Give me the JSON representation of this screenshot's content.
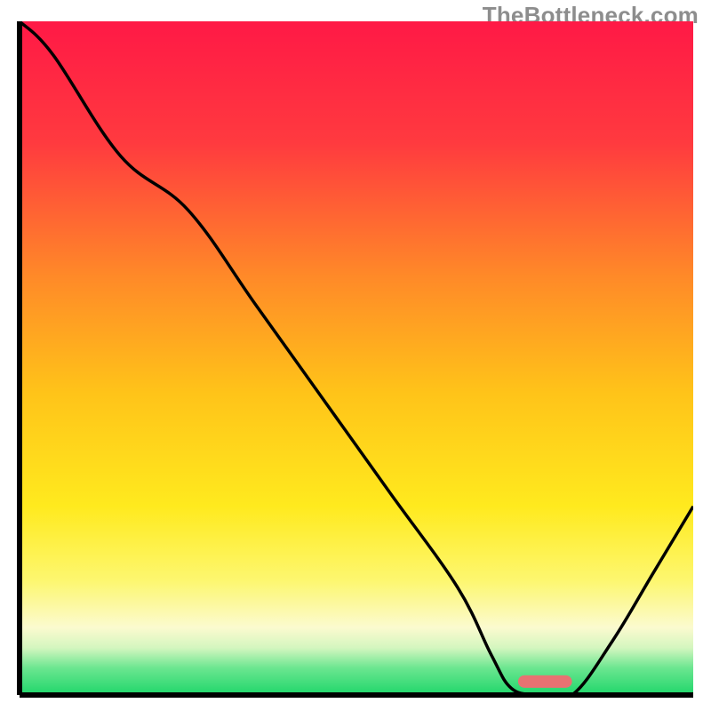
{
  "watermark": "TheBottleneck.com",
  "chart_data": {
    "type": "line",
    "title": "",
    "xlabel": "",
    "ylabel": "",
    "xlim": [
      0,
      100
    ],
    "ylim": [
      0,
      100
    ],
    "grid": false,
    "legend": false,
    "background": "vertical-gradient red→orange→yellow→cream→green",
    "x": [
      0,
      5,
      15,
      25,
      35,
      45,
      55,
      65,
      70,
      73,
      77,
      82,
      88,
      94,
      100
    ],
    "values": [
      100,
      95,
      80,
      72,
      58,
      44,
      30,
      16,
      6,
      1,
      0,
      0,
      8,
      18,
      28
    ],
    "marker": {
      "x_start": 74,
      "x_end": 82,
      "y": 2,
      "color": "#e87272",
      "shape": "pill"
    }
  },
  "colors": {
    "gradient_stops": [
      {
        "offset": 0.0,
        "color": "#ff1946"
      },
      {
        "offset": 0.18,
        "color": "#ff3a3f"
      },
      {
        "offset": 0.38,
        "color": "#ff8a28"
      },
      {
        "offset": 0.55,
        "color": "#ffc319"
      },
      {
        "offset": 0.72,
        "color": "#ffea1e"
      },
      {
        "offset": 0.83,
        "color": "#fdf76f"
      },
      {
        "offset": 0.9,
        "color": "#fbfacf"
      },
      {
        "offset": 0.93,
        "color": "#d4f6bf"
      },
      {
        "offset": 0.96,
        "color": "#6be690"
      },
      {
        "offset": 1.0,
        "color": "#1fd66a"
      }
    ],
    "curve": "#000000",
    "axis": "#000000",
    "marker": "#e87272"
  }
}
